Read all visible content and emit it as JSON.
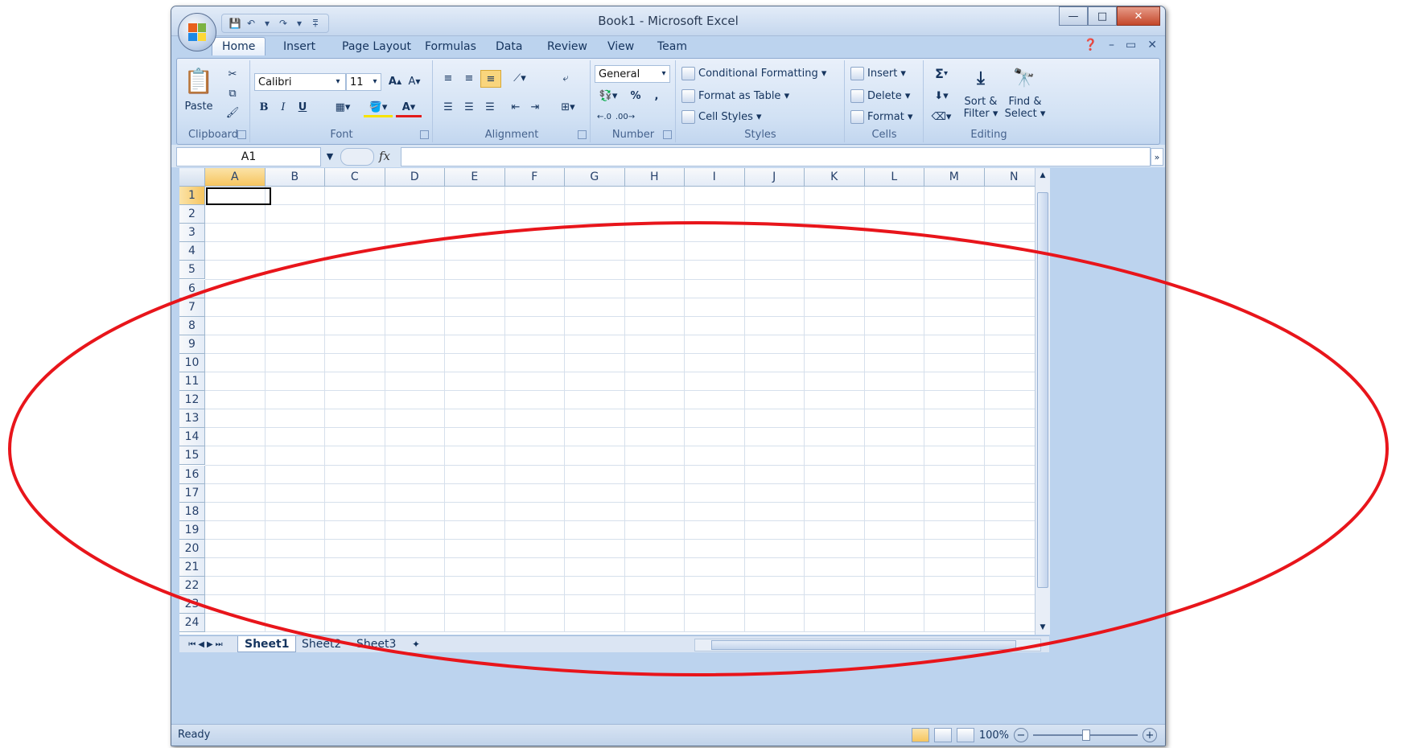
{
  "window": {
    "title": "Book1 - Microsoft Excel",
    "min_glyph": "—",
    "max_glyph": "□",
    "close_glyph": "✕"
  },
  "ribbon_tabs": [
    "Home",
    "Insert",
    "Page Layout",
    "Formulas",
    "Data",
    "Review",
    "View",
    "Team"
  ],
  "active_tab": "Home",
  "clipboard": {
    "paste_label": "Paste",
    "group_label": "Clipboard"
  },
  "font": {
    "family": "Calibri",
    "size": "11",
    "bold": "B",
    "italic": "I",
    "underline": "U",
    "group_label": "Font"
  },
  "alignment": {
    "group_label": "Alignment"
  },
  "number": {
    "format": "General",
    "percent": "%",
    "comma": ",",
    "group_label": "Number"
  },
  "styles": {
    "conditional_formatting": "Conditional Formatting",
    "format_as_table": "Format as Table",
    "cell_styles": "Cell Styles",
    "group_label": "Styles"
  },
  "cells": {
    "insert": "Insert",
    "delete": "Delete",
    "format": "Format",
    "group_label": "Cells"
  },
  "editing": {
    "sum": "Σ",
    "sort_filter_line1": "Sort &",
    "sort_filter_line2": "Filter",
    "find_select_line1": "Find &",
    "find_select_line2": "Select",
    "group_label": "Editing"
  },
  "formula_bar": {
    "name_box": "A1",
    "fx": "fx",
    "formula": ""
  },
  "columns": [
    "A",
    "B",
    "C",
    "D",
    "E",
    "F",
    "G",
    "H",
    "I",
    "J",
    "K",
    "L",
    "M",
    "N"
  ],
  "rows": [
    "1",
    "2",
    "3",
    "4",
    "5",
    "6",
    "7",
    "8",
    "9",
    "10",
    "11",
    "12",
    "13",
    "14",
    "15",
    "16",
    "17",
    "18",
    "19",
    "20",
    "21",
    "22",
    "23",
    "24"
  ],
  "active_cell": "A1",
  "sheets": [
    "Sheet1",
    "Sheet2",
    "Sheet3"
  ],
  "active_sheet": "Sheet1",
  "status": {
    "text": "Ready",
    "zoom": "100%"
  },
  "annotation_color": "#e8151b"
}
